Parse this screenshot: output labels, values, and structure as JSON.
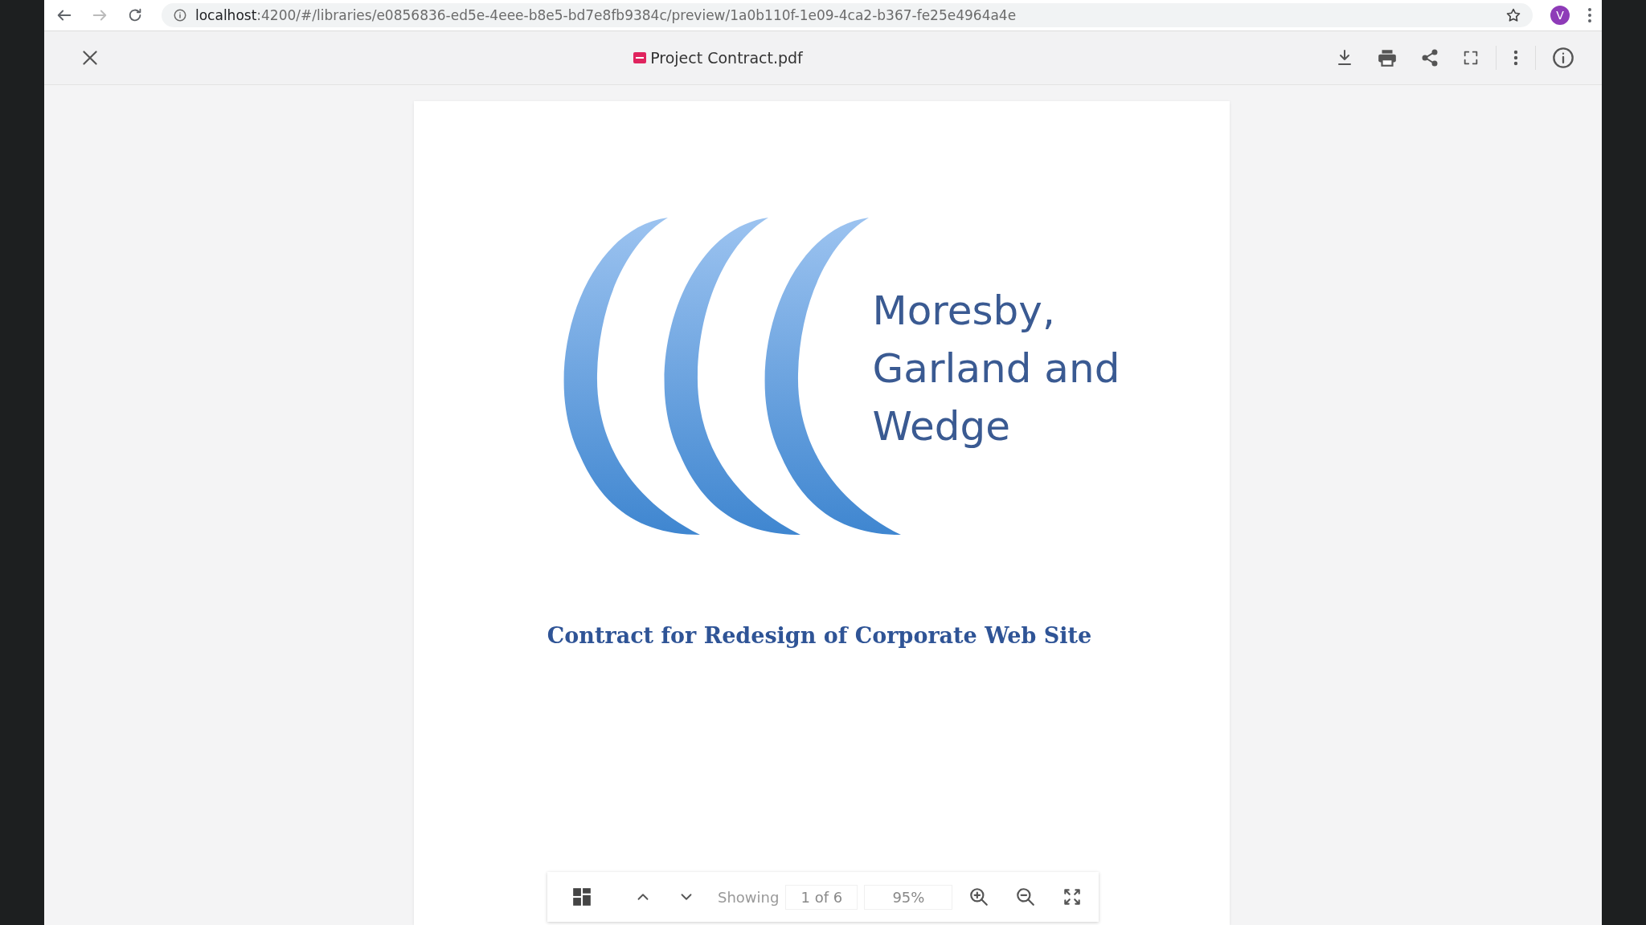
{
  "browser": {
    "url_host": "localhost",
    "url_rest": ":4200/#/libraries/e0856836-ed5e-4eee-b8e5-bd7e8fb9384c/preview/1a0b110f-1e09-4ca2-b367-fe25e4964a4e",
    "profile_initial": "V"
  },
  "viewer": {
    "file_name": "Project Contract.pdf"
  },
  "document": {
    "company_lines": [
      "Moresby,",
      "Garland and",
      "Wedge"
    ],
    "title": "Contract for Redesign of Corporate Web Site"
  },
  "toolbar": {
    "showing_label": "Showing",
    "page_value": "1 of 6",
    "zoom_value": "95%"
  }
}
